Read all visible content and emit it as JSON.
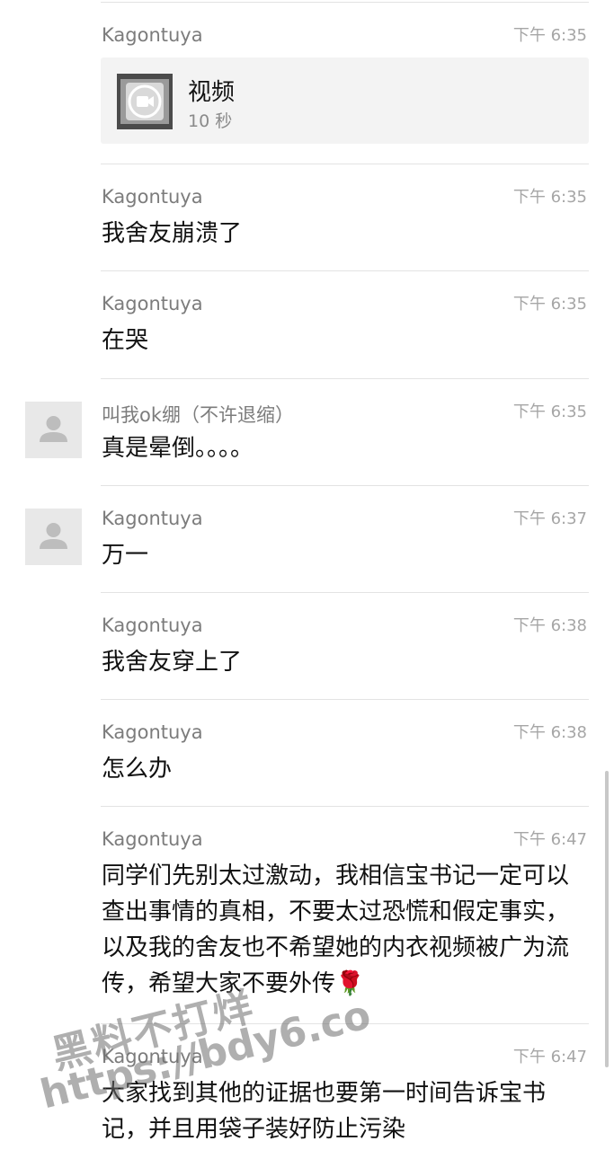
{
  "messages": [
    {
      "sender": "Kagontuya",
      "time": "下午 6:35",
      "type": "video",
      "video": {
        "title": "视频",
        "duration": "10 秒"
      }
    },
    {
      "sender": "Kagontuya",
      "time": "下午 6:35",
      "text": "我舍友崩溃了"
    },
    {
      "sender": "Kagontuya",
      "time": "下午 6:35",
      "text": "在哭"
    },
    {
      "sender": "叫我ok绷（不许退缩）",
      "time": "下午 6:35",
      "text": "真是晕倒。。。。",
      "avatar": "default-avatar"
    },
    {
      "sender": "Kagontuya",
      "time": "下午 6:37",
      "text": "万一",
      "avatar": "default-avatar"
    },
    {
      "sender": "Kagontuya",
      "time": "下午 6:38",
      "text": "我舍友穿上了"
    },
    {
      "sender": "Kagontuya",
      "time": "下午 6:38",
      "text": "怎么办"
    },
    {
      "sender": "Kagontuya",
      "time": "下午 6:47",
      "text": "同学们先别太过激动，我相信宝书记一定可以查出事情的真相，不要太过恐慌和假定事实，以及我的舍友也不希望她的内衣视频被广为流传，希望大家不要外传🌹"
    },
    {
      "sender": "Kagontuya",
      "time": "下午 6:47",
      "text": "大家找到其他的证据也要第一时间告诉宝书记，并且用袋子装好防止污染"
    }
  ],
  "watermark": {
    "line1": "黑料不打烊",
    "line2": "https://bdy6.co"
  },
  "colors": {
    "background": "#ffffff",
    "sender": "#7c7c7c",
    "time": "#a6a6a6",
    "text": "#111111",
    "card": "#f3f3f3"
  }
}
